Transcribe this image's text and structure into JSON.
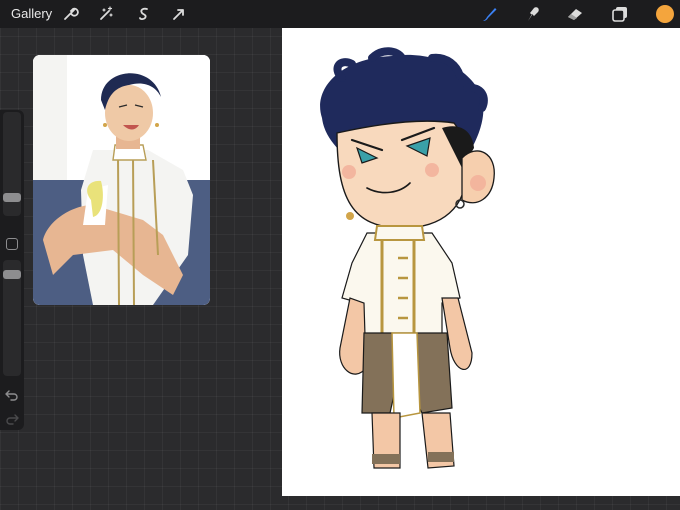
{
  "app": {
    "gallery_label": "Gallery"
  },
  "toolbar": {
    "left_tools": [
      "wrench-icon",
      "magic-wand-icon",
      "selection-icon",
      "transform-icon"
    ],
    "right_tools": [
      "brush-icon",
      "smudge-icon",
      "eraser-icon",
      "layers-icon"
    ],
    "active_tool": "brush-icon",
    "current_color": "#f4a53d",
    "accent_color": "#3b82f6"
  },
  "sidebar": {
    "brush_size_icon": "slider-thumb",
    "opacity_icon": "slider-thumb",
    "modify_icon": "square-icon",
    "undo_icon": "undo-icon",
    "redo_icon": "redo-icon"
  },
  "reference": {
    "description_icon": "reference-image"
  },
  "canvas": {
    "background": "#ffffff"
  }
}
